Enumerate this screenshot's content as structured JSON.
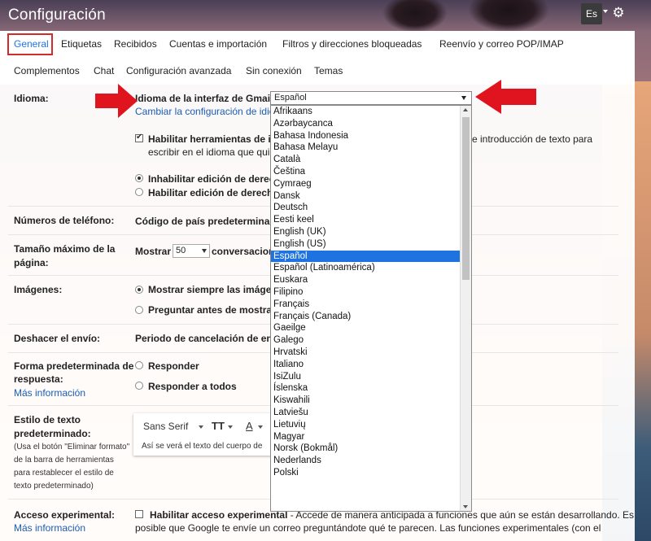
{
  "header": {
    "title": "Configuración",
    "lang_button": "Es"
  },
  "tabs_row1": [
    "General",
    "Etiquetas",
    "Recibidos",
    "Cuentas e importación",
    "Filtros y direcciones bloqueadas",
    "Reenvío y correo POP/IMAP"
  ],
  "tabs_row2": [
    "Complementos",
    "Chat",
    "Configuración avanzada",
    "Sin conexión",
    "Temas"
  ],
  "language": {
    "label": "Idioma:",
    "field_label": "Idioma de la interfaz de Gmail:",
    "selected": "Español",
    "change_link": "Cambiar la configuración de idio",
    "enable_tools": "Habilitar herramientas de int",
    "enable_tools_tail": "e introducción de texto para",
    "enable_tools_sub": "escribir en el idioma que qui",
    "rtl_off": "Inhabilitar edición de derech",
    "rtl_on": "Habilitar edición de derecha",
    "options": [
      "Afrikaans",
      "Azərbaycanca",
      "Bahasa Indonesia",
      "Bahasa Melayu",
      "Català",
      "Čeština",
      "Cymraeg",
      "Dansk",
      "Deutsch",
      "Eesti keel",
      "English (UK)",
      "English (US)",
      "Español",
      "Español (Latinoamérica)",
      "Euskara",
      "Filipino",
      "Français",
      "Français (Canada)",
      "Gaeilge",
      "Galego",
      "Hrvatski",
      "Italiano",
      "IsiZulu",
      "Íslenska",
      "Kiswahili",
      "Latviešu",
      "Lietuvių",
      "Magyar",
      "Norsk (Bokmål)",
      "Nederlands",
      "Polski"
    ]
  },
  "phone": {
    "label": "Números de teléfono:",
    "text": "Código de país predeterminado"
  },
  "page_size": {
    "label_1": "Tamaño máximo de la",
    "label_2": "página:",
    "show": "Mostrar",
    "value": "50",
    "tail": "conversacion"
  },
  "images": {
    "label": "Imágenes:",
    "always": "Mostrar siempre las imágen",
    "ask": "Preguntar antes de mostrar"
  },
  "undo": {
    "label": "Deshacer el envío:",
    "text": "Periodo de cancelación de enví"
  },
  "reply": {
    "label_1": "Forma predeterminada de",
    "label_2": "respuesta:",
    "more": "Más información",
    "reply": "Responder",
    "reply_all": "Responder a todos"
  },
  "text_style": {
    "label_1": "Estilo de texto",
    "label_2": "predeterminado:",
    "help": [
      "(Usa el botón \"Eliminar formato\"",
      "de la barra de herramientas",
      "para restablecer el estilo de",
      "texto predeterminado)"
    ],
    "font": "Sans Serif",
    "size_icon": "TT",
    "color_icon": "A",
    "preview": "Así se verá el texto del cuerpo de"
  },
  "experimental": {
    "label": "Acceso experimental:",
    "more": "Más información",
    "title": "Habilitar acceso experimental",
    "desc_1": " - Accede de manera anticipada a funciones que aún se están desarrollando. Es",
    "desc_2": "posible que Google te envíe un correo preguntándote qué te parecen. Las funciones experimentales (con el"
  },
  "colors": {
    "accent": "#1a73e8",
    "highlight": "#1e73e0",
    "annotation": "#e0141e"
  }
}
